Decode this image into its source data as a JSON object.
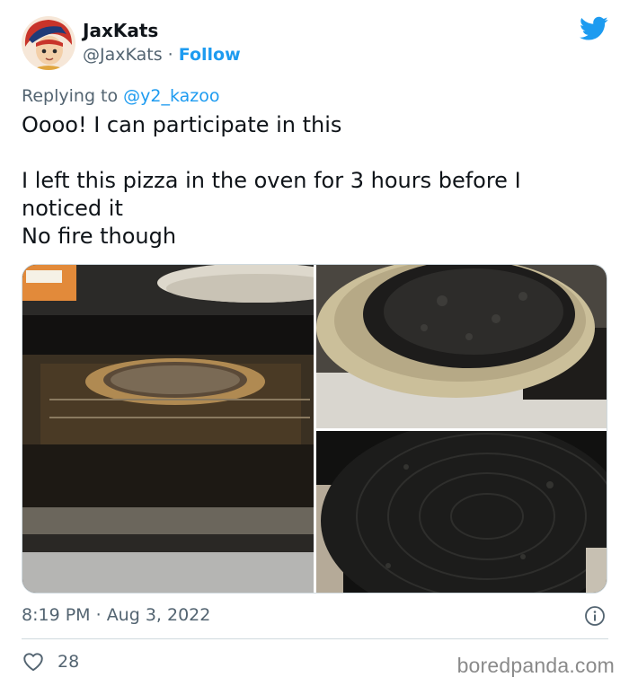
{
  "author": {
    "display_name": "JaxKats",
    "handle": "@JaxKats",
    "separator": " · ",
    "follow_label": "Follow",
    "avatar_icon": "anime-avatar-red-hair"
  },
  "reply": {
    "prefix": "Replying to ",
    "mention": "@y2_kazoo"
  },
  "tweet": {
    "lines": [
      "Oooo! I can participate in this",
      "",
      "I left this pizza in the oven for 3 hours before I noticed it",
      "No fire though"
    ]
  },
  "media": {
    "photos": [
      {
        "description_icon": "oven-photo"
      },
      {
        "description_icon": "burnt-pizza-pan-photo"
      },
      {
        "description_icon": "burnt-pizza-closeup-photo"
      }
    ]
  },
  "meta": {
    "time": "8:19 PM",
    "separator": " · ",
    "date": "Aug 3, 2022"
  },
  "engagement": {
    "likes": "28"
  },
  "watermark": "boredpanda.com",
  "colors": {
    "accent": "#1d9bf0",
    "secondary_text": "#536471",
    "primary_text": "#0f1419",
    "divider": "#cfd9de"
  }
}
